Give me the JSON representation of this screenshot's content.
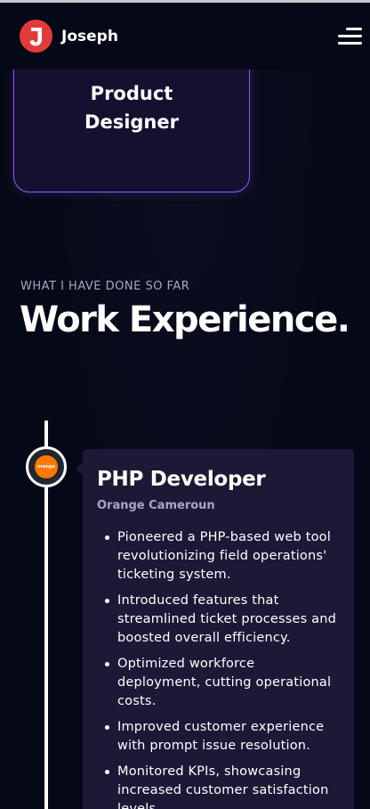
{
  "navbar": {
    "logo_letter": "J",
    "brand_name": "Joseph",
    "menu_icon": "hamburger-menu-icon"
  },
  "service_card": {
    "title": "Product Designer"
  },
  "experience_section": {
    "subtitle": "What I have done so far",
    "title": "Work Experience."
  },
  "experiences": [
    {
      "company_logo_text": "orange",
      "title": "PHP Developer",
      "company": "Orange Cameroun",
      "points": [
        "Pioneered a PHP-based web tool revolutionizing field operations' ticketing system.",
        "Introduced features that streamlined ticket processes and boosted overall efficiency.",
        "Optimized workforce deployment, cutting operational costs.",
        "Improved customer experience with prompt issue resolution.",
        "Monitored KPIs, showcasing increased customer satisfaction levels."
      ]
    }
  ],
  "colors": {
    "background": "#050816",
    "card": "#1d1836",
    "accent_purple": "#8b5cf6",
    "logo_red": "#e23a3a",
    "orange_brand": "#ff7900",
    "secondary_text": "#aaa6c3"
  }
}
